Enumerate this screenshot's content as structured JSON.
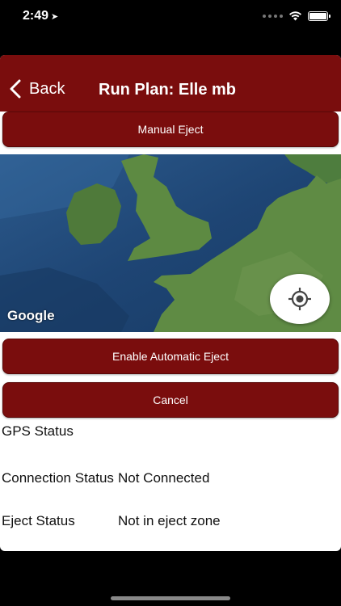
{
  "status_bar": {
    "time": "2:49",
    "icons": [
      "location-arrow-icon",
      "signal-dots-icon",
      "wifi-icon",
      "battery-icon"
    ]
  },
  "nav": {
    "back_label": "Back",
    "title": "Run Plan: Elle mb"
  },
  "buttons": {
    "manual_eject": "Manual Eject",
    "enable_auto_eject": "Enable Automatic Eject",
    "cancel": "Cancel"
  },
  "map": {
    "attribution": "Google",
    "locate_icon": "my-location-icon"
  },
  "status": {
    "gps_label": "GPS Status",
    "gps_value": "",
    "connection_label": "Connection Status",
    "connection_value": "Not Connected",
    "eject_label": "Eject Status",
    "eject_value": "Not in eject zone"
  },
  "colors": {
    "brand": "#7a0d0d",
    "background": "#000000",
    "surface": "#ffffff"
  }
}
